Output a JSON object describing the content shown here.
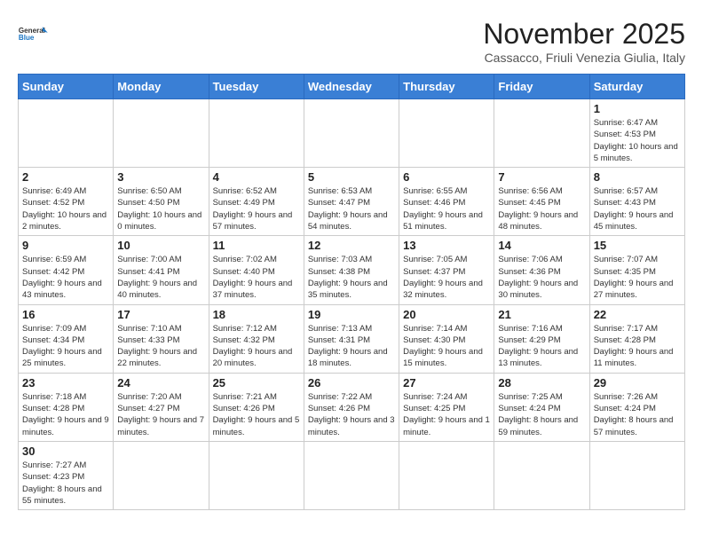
{
  "logo": {
    "text_general": "General",
    "text_blue": "Blue"
  },
  "title": "November 2025",
  "subtitle": "Cassacco, Friuli Venezia Giulia, Italy",
  "days_of_week": [
    "Sunday",
    "Monday",
    "Tuesday",
    "Wednesday",
    "Thursday",
    "Friday",
    "Saturday"
  ],
  "weeks": [
    [
      {
        "day": "",
        "info": ""
      },
      {
        "day": "",
        "info": ""
      },
      {
        "day": "",
        "info": ""
      },
      {
        "day": "",
        "info": ""
      },
      {
        "day": "",
        "info": ""
      },
      {
        "day": "",
        "info": ""
      },
      {
        "day": "1",
        "info": "Sunrise: 6:47 AM\nSunset: 4:53 PM\nDaylight: 10 hours and 5 minutes."
      }
    ],
    [
      {
        "day": "2",
        "info": "Sunrise: 6:49 AM\nSunset: 4:52 PM\nDaylight: 10 hours and 2 minutes."
      },
      {
        "day": "3",
        "info": "Sunrise: 6:50 AM\nSunset: 4:50 PM\nDaylight: 10 hours and 0 minutes."
      },
      {
        "day": "4",
        "info": "Sunrise: 6:52 AM\nSunset: 4:49 PM\nDaylight: 9 hours and 57 minutes."
      },
      {
        "day": "5",
        "info": "Sunrise: 6:53 AM\nSunset: 4:47 PM\nDaylight: 9 hours and 54 minutes."
      },
      {
        "day": "6",
        "info": "Sunrise: 6:55 AM\nSunset: 4:46 PM\nDaylight: 9 hours and 51 minutes."
      },
      {
        "day": "7",
        "info": "Sunrise: 6:56 AM\nSunset: 4:45 PM\nDaylight: 9 hours and 48 minutes."
      },
      {
        "day": "8",
        "info": "Sunrise: 6:57 AM\nSunset: 4:43 PM\nDaylight: 9 hours and 45 minutes."
      }
    ],
    [
      {
        "day": "9",
        "info": "Sunrise: 6:59 AM\nSunset: 4:42 PM\nDaylight: 9 hours and 43 minutes."
      },
      {
        "day": "10",
        "info": "Sunrise: 7:00 AM\nSunset: 4:41 PM\nDaylight: 9 hours and 40 minutes."
      },
      {
        "day": "11",
        "info": "Sunrise: 7:02 AM\nSunset: 4:40 PM\nDaylight: 9 hours and 37 minutes."
      },
      {
        "day": "12",
        "info": "Sunrise: 7:03 AM\nSunset: 4:38 PM\nDaylight: 9 hours and 35 minutes."
      },
      {
        "day": "13",
        "info": "Sunrise: 7:05 AM\nSunset: 4:37 PM\nDaylight: 9 hours and 32 minutes."
      },
      {
        "day": "14",
        "info": "Sunrise: 7:06 AM\nSunset: 4:36 PM\nDaylight: 9 hours and 30 minutes."
      },
      {
        "day": "15",
        "info": "Sunrise: 7:07 AM\nSunset: 4:35 PM\nDaylight: 9 hours and 27 minutes."
      }
    ],
    [
      {
        "day": "16",
        "info": "Sunrise: 7:09 AM\nSunset: 4:34 PM\nDaylight: 9 hours and 25 minutes."
      },
      {
        "day": "17",
        "info": "Sunrise: 7:10 AM\nSunset: 4:33 PM\nDaylight: 9 hours and 22 minutes."
      },
      {
        "day": "18",
        "info": "Sunrise: 7:12 AM\nSunset: 4:32 PM\nDaylight: 9 hours and 20 minutes."
      },
      {
        "day": "19",
        "info": "Sunrise: 7:13 AM\nSunset: 4:31 PM\nDaylight: 9 hours and 18 minutes."
      },
      {
        "day": "20",
        "info": "Sunrise: 7:14 AM\nSunset: 4:30 PM\nDaylight: 9 hours and 15 minutes."
      },
      {
        "day": "21",
        "info": "Sunrise: 7:16 AM\nSunset: 4:29 PM\nDaylight: 9 hours and 13 minutes."
      },
      {
        "day": "22",
        "info": "Sunrise: 7:17 AM\nSunset: 4:28 PM\nDaylight: 9 hours and 11 minutes."
      }
    ],
    [
      {
        "day": "23",
        "info": "Sunrise: 7:18 AM\nSunset: 4:28 PM\nDaylight: 9 hours and 9 minutes."
      },
      {
        "day": "24",
        "info": "Sunrise: 7:20 AM\nSunset: 4:27 PM\nDaylight: 9 hours and 7 minutes."
      },
      {
        "day": "25",
        "info": "Sunrise: 7:21 AM\nSunset: 4:26 PM\nDaylight: 9 hours and 5 minutes."
      },
      {
        "day": "26",
        "info": "Sunrise: 7:22 AM\nSunset: 4:26 PM\nDaylight: 9 hours and 3 minutes."
      },
      {
        "day": "27",
        "info": "Sunrise: 7:24 AM\nSunset: 4:25 PM\nDaylight: 9 hours and 1 minute."
      },
      {
        "day": "28",
        "info": "Sunrise: 7:25 AM\nSunset: 4:24 PM\nDaylight: 8 hours and 59 minutes."
      },
      {
        "day": "29",
        "info": "Sunrise: 7:26 AM\nSunset: 4:24 PM\nDaylight: 8 hours and 57 minutes."
      }
    ],
    [
      {
        "day": "30",
        "info": "Sunrise: 7:27 AM\nSunset: 4:23 PM\nDaylight: 8 hours and 55 minutes."
      },
      {
        "day": "",
        "info": ""
      },
      {
        "day": "",
        "info": ""
      },
      {
        "day": "",
        "info": ""
      },
      {
        "day": "",
        "info": ""
      },
      {
        "day": "",
        "info": ""
      },
      {
        "day": "",
        "info": ""
      }
    ]
  ]
}
